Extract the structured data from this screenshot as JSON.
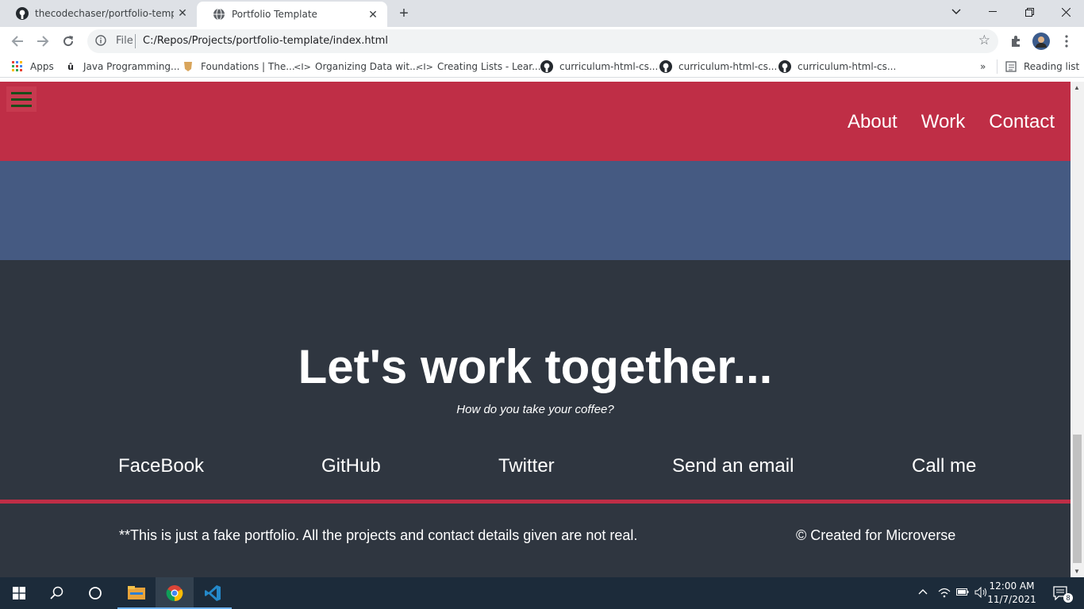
{
  "browser": {
    "tabs": [
      {
        "title": "thecodechaser/portfolio-templat",
        "icon": "github-icon"
      },
      {
        "title": "Portfolio Template",
        "icon": "globe-icon"
      }
    ],
    "address": {
      "scheme": "File",
      "url": "C:/Repos/Projects/portfolio-template/index.html"
    },
    "bookmarks": [
      {
        "label": "Apps",
        "icon": "apps-grid-icon"
      },
      {
        "label": "Java Programming...",
        "icon": "udemy-icon"
      },
      {
        "label": "Foundations | The...",
        "icon": "odin-icon"
      },
      {
        "label": "Organizing Data wit...",
        "icon": "code-icon"
      },
      {
        "label": "Creating Lists - Lear...",
        "icon": "code-icon"
      },
      {
        "label": "curriculum-html-cs...",
        "icon": "github-icon"
      },
      {
        "label": "curriculum-html-cs...",
        "icon": "github-icon"
      },
      {
        "label": "curriculum-html-cs...",
        "icon": "github-icon"
      }
    ],
    "overflow": "»",
    "reading_list": "Reading list"
  },
  "page": {
    "nav": [
      "About",
      "Work",
      "Contact"
    ],
    "heading": "Let's work together...",
    "subheading": "How do you take your coffee?",
    "links": [
      "FaceBook",
      "GitHub",
      "Twitter",
      "Send an email",
      "Call me"
    ],
    "footer_note": "**This is just a fake portfolio. All the projects and contact details given are not real.",
    "footer_credit": "© Created for Microverse",
    "colors": {
      "header": "#bf2e46",
      "band": "#455a82",
      "contact": "#2f3640"
    }
  },
  "taskbar": {
    "time": "12:00 AM",
    "date": "11/7/2021",
    "notifications": "8"
  }
}
